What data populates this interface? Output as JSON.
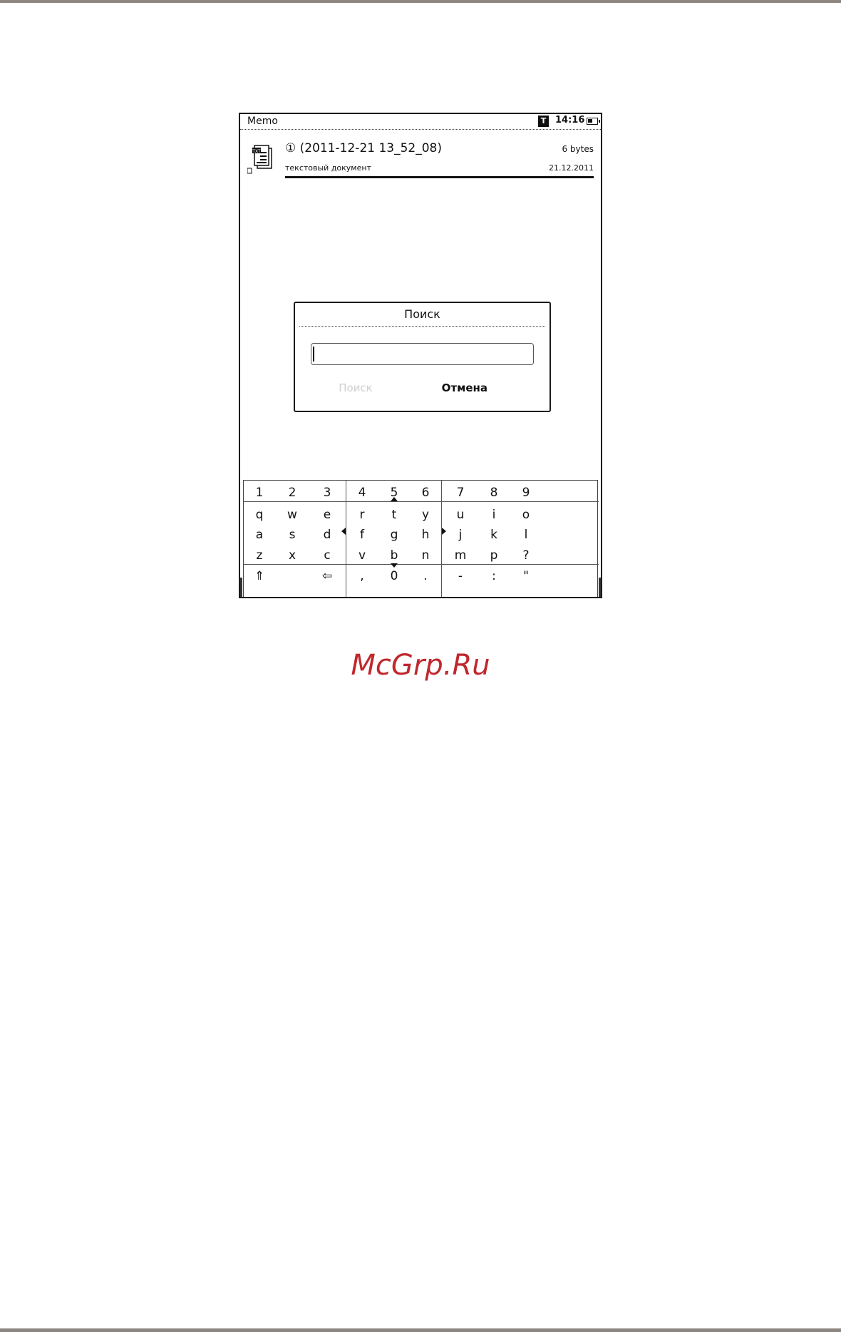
{
  "status_bar": {
    "app_title": "Memo",
    "mode_icon_label": "T",
    "time": "14:16",
    "battery_icon": "battery-icon"
  },
  "file_entry": {
    "icon": "txt-document-icon",
    "icon_badge": "TXT",
    "title": "① (2011-12-21 13_52_08)",
    "size": "6 bytes",
    "type": "текстовый документ",
    "date": "21.12.2011"
  },
  "dialog": {
    "title": "Поиск",
    "input_value": "",
    "search_button": "Поиск",
    "cancel_button": "Отмена"
  },
  "keyboard": {
    "rows": [
      [
        "1",
        "2",
        "3",
        "4",
        "5",
        "6",
        "7",
        "8",
        "9"
      ],
      [
        "q",
        "w",
        "e",
        "r",
        "t",
        "y",
        "u",
        "i",
        "o"
      ],
      [
        "a",
        "s",
        "d",
        "f",
        "g",
        "h",
        "j",
        "k",
        "l"
      ],
      [
        "z",
        "x",
        "c",
        "v",
        "b",
        "n",
        "m",
        "p",
        "?"
      ],
      [
        "⇑",
        "",
        "⇦",
        ",",
        "0",
        ".",
        "-",
        ":",
        "\""
      ]
    ]
  },
  "watermark": "McGrp.Ru",
  "colors": {
    "watermark": "#c0282d",
    "disabled_text": "#cfcfcf",
    "page_rule": "#8c8580"
  }
}
